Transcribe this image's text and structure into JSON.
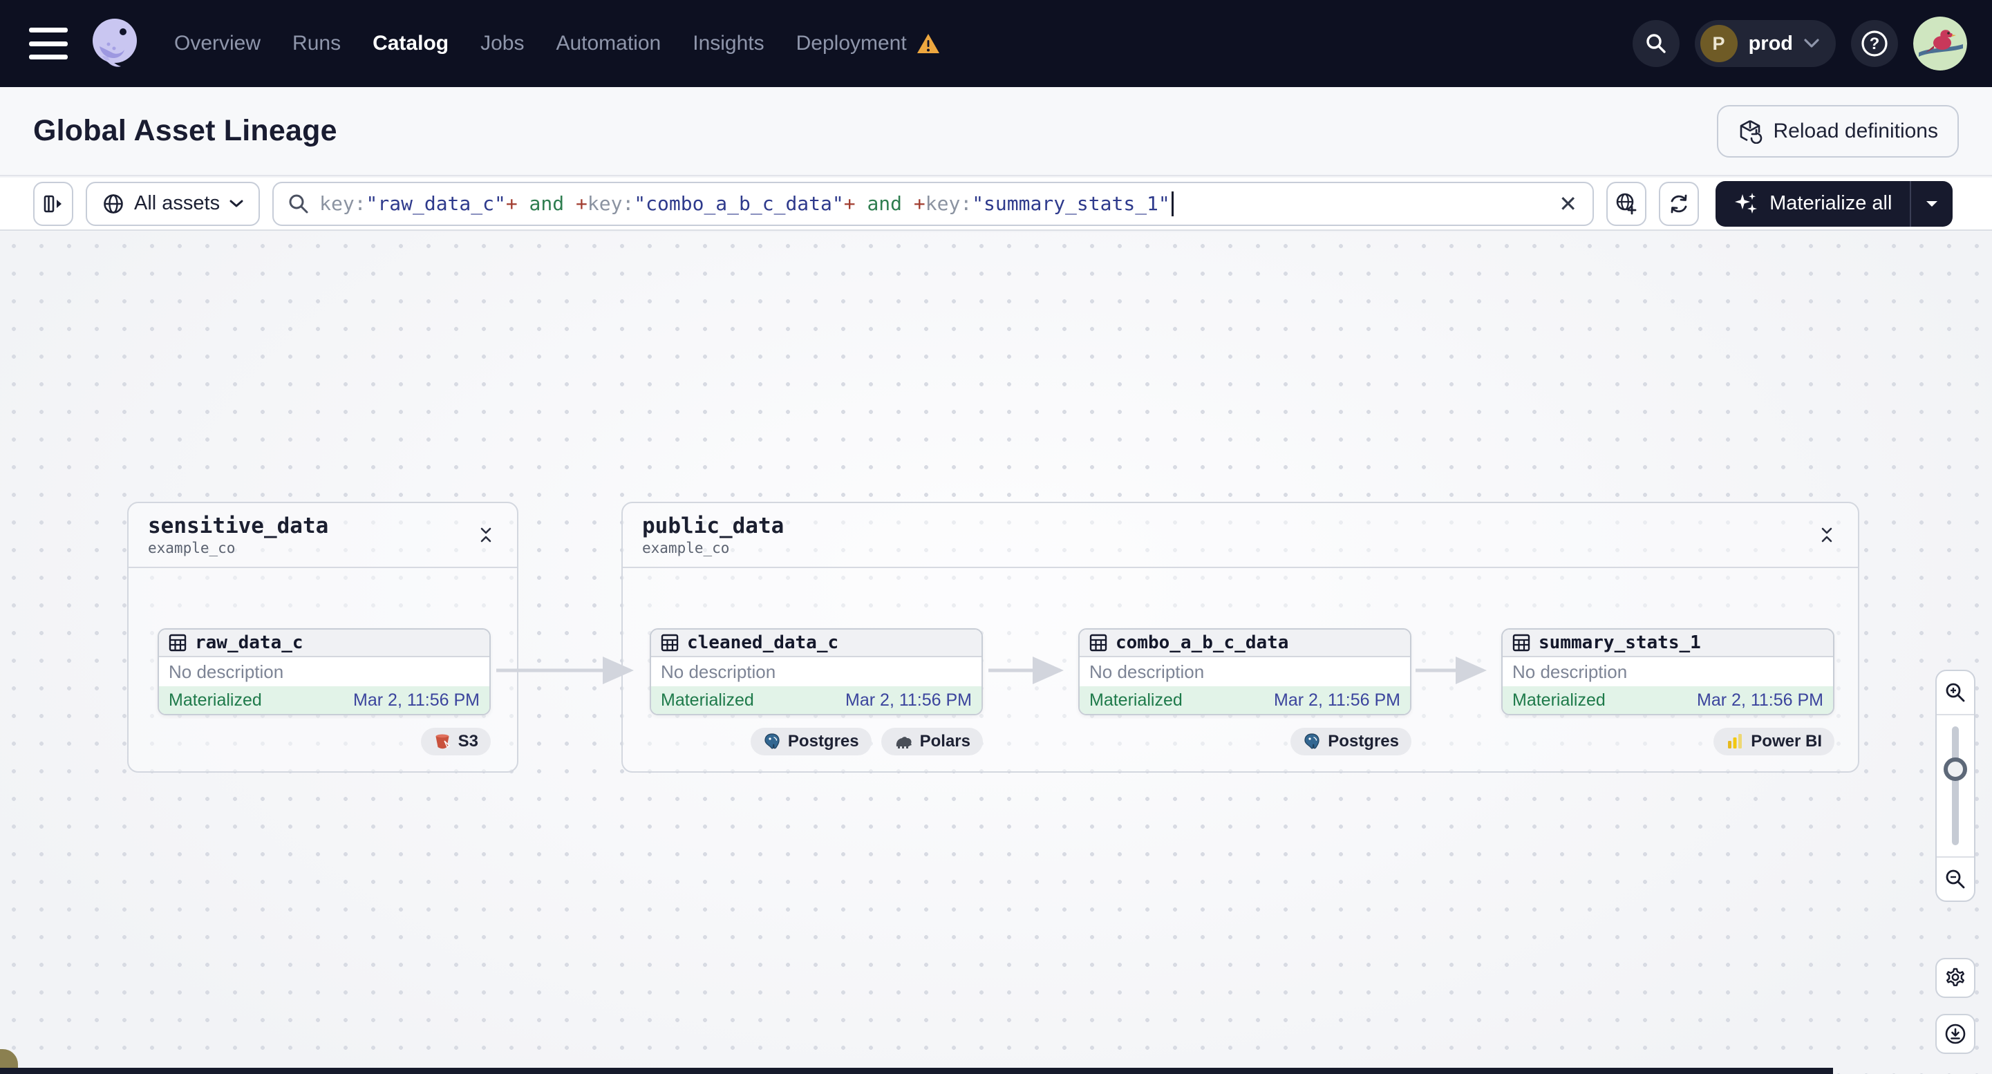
{
  "nav": {
    "items": [
      {
        "label": "Overview",
        "active": false
      },
      {
        "label": "Runs",
        "active": false
      },
      {
        "label": "Catalog",
        "active": true
      },
      {
        "label": "Jobs",
        "active": false
      },
      {
        "label": "Automation",
        "active": false
      },
      {
        "label": "Insights",
        "active": false
      },
      {
        "label": "Deployment",
        "active": false,
        "warning": true
      }
    ],
    "deployment_switcher": {
      "initial": "P",
      "name": "prod"
    }
  },
  "header": {
    "title": "Global Asset Lineage",
    "reload_label": "Reload definitions"
  },
  "toolbar": {
    "scope": {
      "label": "All assets"
    },
    "query": {
      "value": "key:\"raw_data_c\"+ and +key:\"combo_a_b_c_data\"+ and +key:\"summary_stats_1\"",
      "segments": [
        {
          "text": "key:",
          "type": "key"
        },
        {
          "text": "\"raw_data_c\"",
          "type": "value"
        },
        {
          "text": "+",
          "type": "op"
        },
        {
          "text": " and ",
          "type": "and"
        },
        {
          "text": "+",
          "type": "op"
        },
        {
          "text": "key:",
          "type": "key"
        },
        {
          "text": "\"combo_a_b_c_data\"",
          "type": "value"
        },
        {
          "text": "+",
          "type": "op"
        },
        {
          "text": " and ",
          "type": "and"
        },
        {
          "text": "+",
          "type": "op"
        },
        {
          "text": "key:",
          "type": "key"
        },
        {
          "text": "\"summary_stats_1\"",
          "type": "value"
        }
      ]
    },
    "materialize_label": "Materialize all"
  },
  "graph": {
    "groups": [
      {
        "name": "sensitive_data",
        "subtitle": "example_co"
      },
      {
        "name": "public_data",
        "subtitle": "example_co"
      }
    ],
    "nodes": [
      {
        "name": "raw_data_c",
        "description": "No description",
        "status": "Materialized",
        "materialized_at": "Mar 2, 11:56 PM",
        "tags": [
          {
            "label": "S3",
            "icon": "s3-icon"
          }
        ]
      },
      {
        "name": "cleaned_data_c",
        "description": "No description",
        "status": "Materialized",
        "materialized_at": "Mar 2, 11:56 PM",
        "tags": [
          {
            "label": "Postgres",
            "icon": "postgres-icon"
          },
          {
            "label": "Polars",
            "icon": "polars-icon"
          }
        ]
      },
      {
        "name": "combo_a_b_c_data",
        "description": "No description",
        "status": "Materialized",
        "materialized_at": "Mar 2, 11:56 PM",
        "tags": [
          {
            "label": "Postgres",
            "icon": "postgres-icon"
          }
        ]
      },
      {
        "name": "summary_stats_1",
        "description": "No description",
        "status": "Materialized",
        "materialized_at": "Mar 2, 11:56 PM",
        "tags": [
          {
            "label": "Power BI",
            "icon": "powerbi-icon"
          }
        ]
      }
    ]
  },
  "colors": {
    "nav_bg": "#0d1021",
    "logo_lavender": "#c9c6f1",
    "warning": "#eda73f",
    "materialized_bg": "#e2f3e8",
    "materialized_text": "#1e7a4a",
    "timestamp_text": "#3b449d",
    "query_key": "#8b93a1",
    "query_value": "#2e3a8c",
    "query_op": "#a13c2f",
    "query_and": "#2e7d4f",
    "dark_button_bg": "#171a2d",
    "s3_red": "#c9523d",
    "postgres_blue": "#336791",
    "powerbi_yellow": "#e6b91e"
  }
}
